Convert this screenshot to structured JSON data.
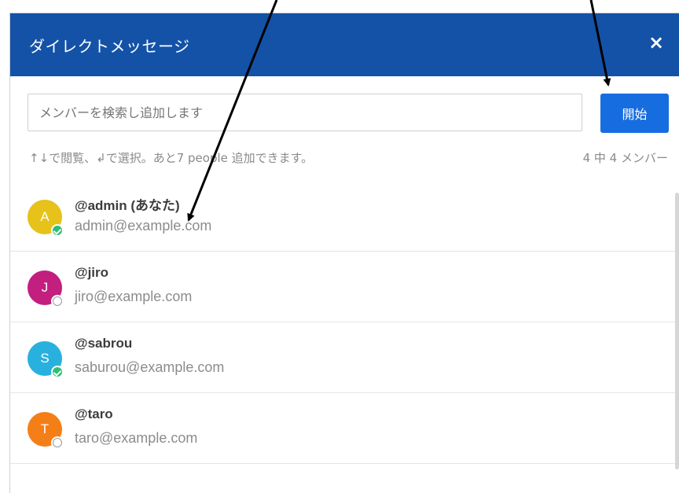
{
  "header": {
    "title": "ダイレクトメッセージ",
    "close_label": "×"
  },
  "search": {
    "placeholder": "メンバーを検索し追加します"
  },
  "start_button": {
    "label": "開始"
  },
  "hint": "↑↓で閲覧、↲で選択。あと7 people 追加できます。",
  "member_count": "4 中 4 メンバー",
  "members": [
    {
      "initial": "A",
      "username": "@admin (あなた)",
      "email": "admin@example.com",
      "status": "online",
      "color": "#e6c21a"
    },
    {
      "initial": "J",
      "username": "@jiro",
      "email": "jiro@example.com",
      "status": "offline",
      "color": "#c21f7f"
    },
    {
      "initial": "S",
      "username": "@sabrou",
      "email": "saburou@example.com",
      "status": "online",
      "color": "#28b1de"
    },
    {
      "initial": "T",
      "username": "@taro",
      "email": "taro@example.com",
      "status": "offline",
      "color": "#f57f17"
    }
  ],
  "colors": {
    "header_bg": "#1452a8",
    "button_bg": "#166de0",
    "online": "#2dbf74"
  }
}
